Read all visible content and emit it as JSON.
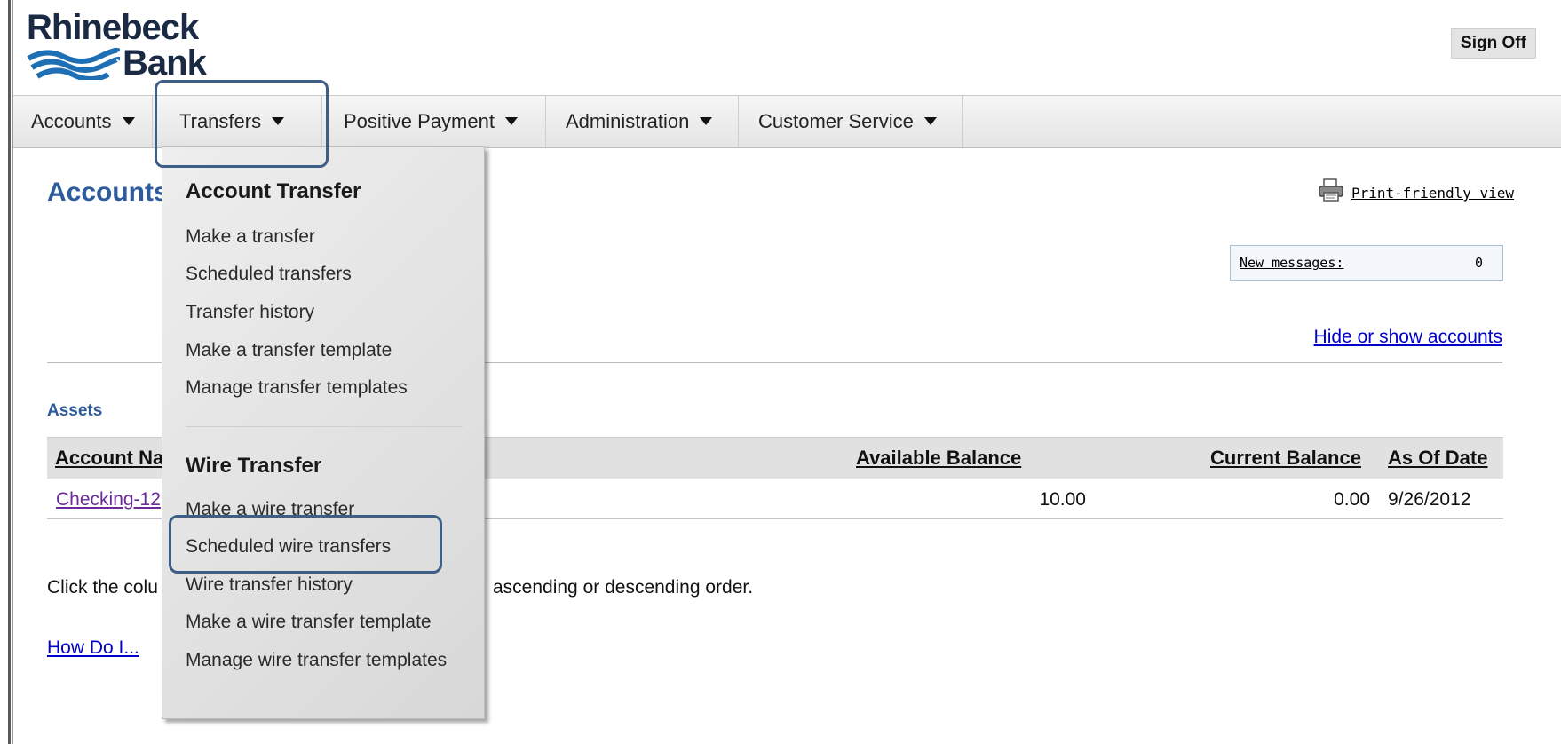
{
  "logo": {
    "line1": "Rhinebeck",
    "line2": "Bank"
  },
  "header": {
    "signoff_label": "Sign Off"
  },
  "nav": {
    "items": [
      {
        "label": "Accounts"
      },
      {
        "label": "Transfers"
      },
      {
        "label": "Positive Payment"
      },
      {
        "label": "Administration"
      },
      {
        "label": "Customer Service"
      }
    ]
  },
  "dropdown": {
    "sections": [
      {
        "heading": "Account Transfer",
        "items": [
          "Make a transfer",
          "Scheduled transfers",
          "Transfer history",
          "Make a transfer template",
          "Manage transfer templates"
        ]
      },
      {
        "heading": "Wire Transfer",
        "items": [
          "Make a wire transfer",
          "Scheduled wire transfers",
          "Wire transfer history",
          "Make a wire transfer template",
          "Manage wire transfer templates"
        ]
      }
    ]
  },
  "main": {
    "title": "Accounts",
    "print_link": "Print-friendly view",
    "messages": {
      "label": "New messages:",
      "count": "0"
    },
    "hide_link": "Hide or show accounts",
    "assets_heading": "Assets",
    "table": {
      "headers": {
        "account_name": "Account Na",
        "available_balance": "Available Balance",
        "current_balance": "Current Balance",
        "as_of_date": "As Of Date"
      },
      "rows": [
        {
          "account_name": "Checking-12",
          "available_balance": "10.00",
          "current_balance": "0.00",
          "as_of_date": "9/26/2012"
        }
      ]
    },
    "note_start": "Click the colu",
    "note_end": "ascending or descending order.",
    "howdo": "How Do I..."
  },
  "colors": {
    "brand": "#1b2a44",
    "title_blue": "#2d5b9c",
    "link_blue": "#0000cc",
    "highlight": "#3d5f86"
  }
}
